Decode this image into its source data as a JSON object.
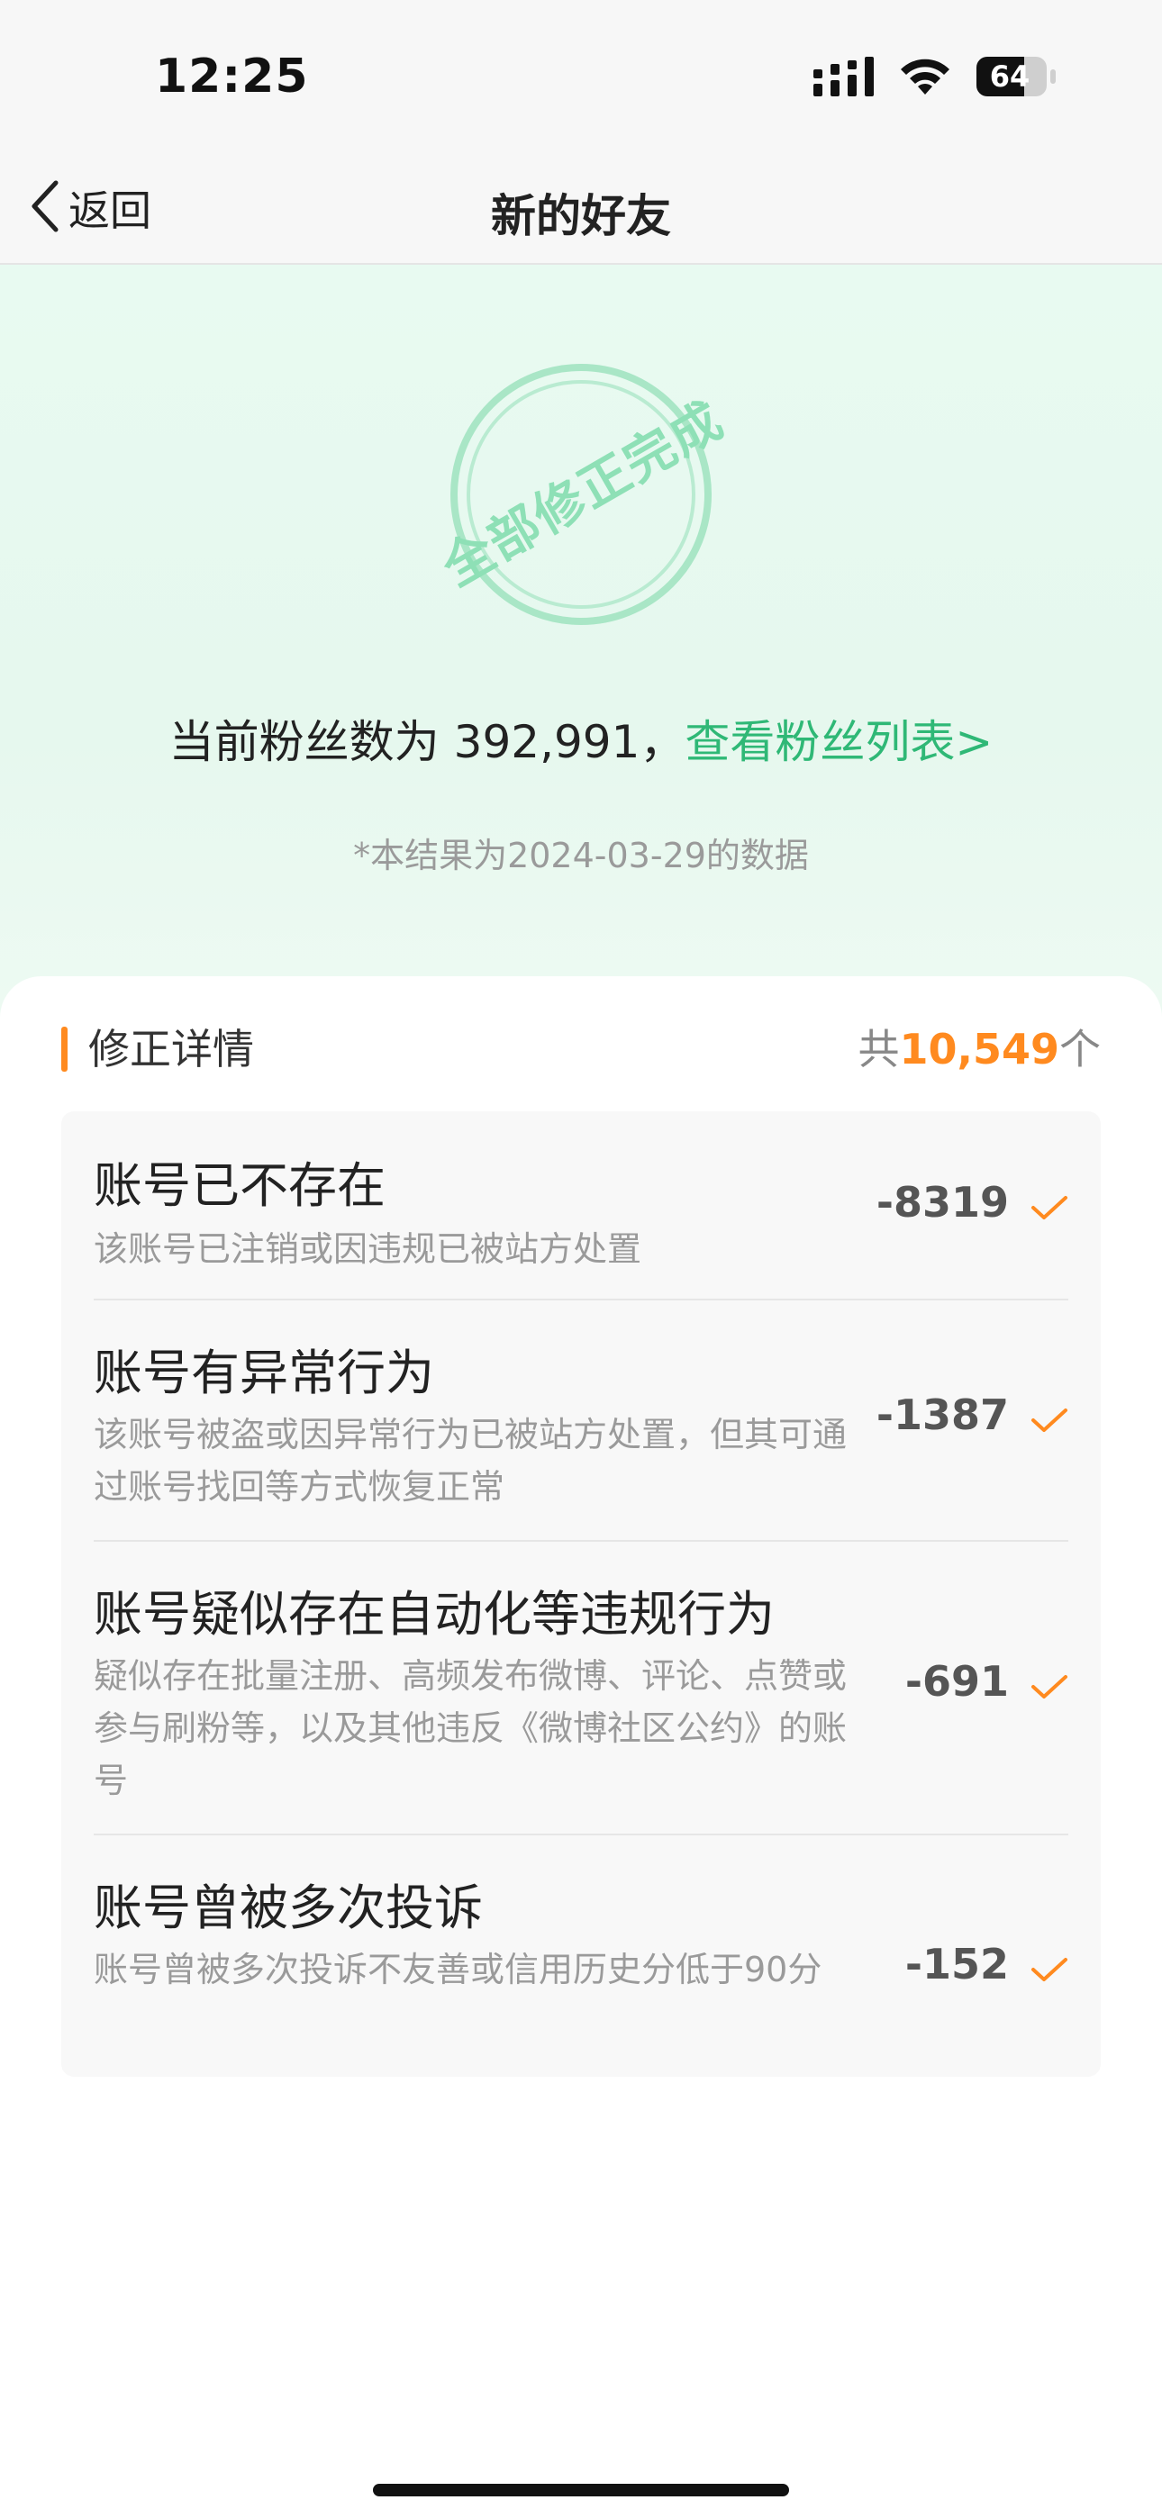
{
  "status_bar": {
    "time": "12:25",
    "battery": "64",
    "icons": [
      "signal-icon",
      "wifi-icon",
      "battery-icon"
    ]
  },
  "nav": {
    "back_label": "返回",
    "title": "新的好友"
  },
  "hero": {
    "stamp_text": "全部修正完成",
    "fans_prefix": "当前粉丝数为",
    "fans_count": "392,991",
    "fans_separator": "，",
    "fans_link": "查看粉丝列表>",
    "data_note": "*本结果为2024-03-29的数据"
  },
  "detail": {
    "title": "修正详情",
    "total_prefix": "共",
    "total_count": "10,549",
    "total_suffix": "个",
    "items": [
      {
        "title": "账号已不存在",
        "desc": "该账号已注销或因违规已被站方处置",
        "count": "-8319"
      },
      {
        "title": "账号有异常行为",
        "desc": "该账号被盗或因异常行为已被站方处置，但其可通过账号找回等方式恢复正常",
        "count": "-1387"
      },
      {
        "title": "账号疑似存在自动化等违规行为",
        "desc": "疑似存在批量注册、高频发布微博、评论、点赞或参与刷粉等，以及其他违反《微博社区公约》的账号",
        "count": "-691"
      },
      {
        "title": "账号曾被多次投诉",
        "desc": "账号曾被多次投诉不友善或信用历史分低于90分",
        "count": "-152"
      }
    ]
  },
  "colors": {
    "accent_orange": "#ff8a1f",
    "link_green": "#2fb876",
    "stamp_green": "#8ee0b6",
    "hero_bg": "#e8faf1"
  }
}
